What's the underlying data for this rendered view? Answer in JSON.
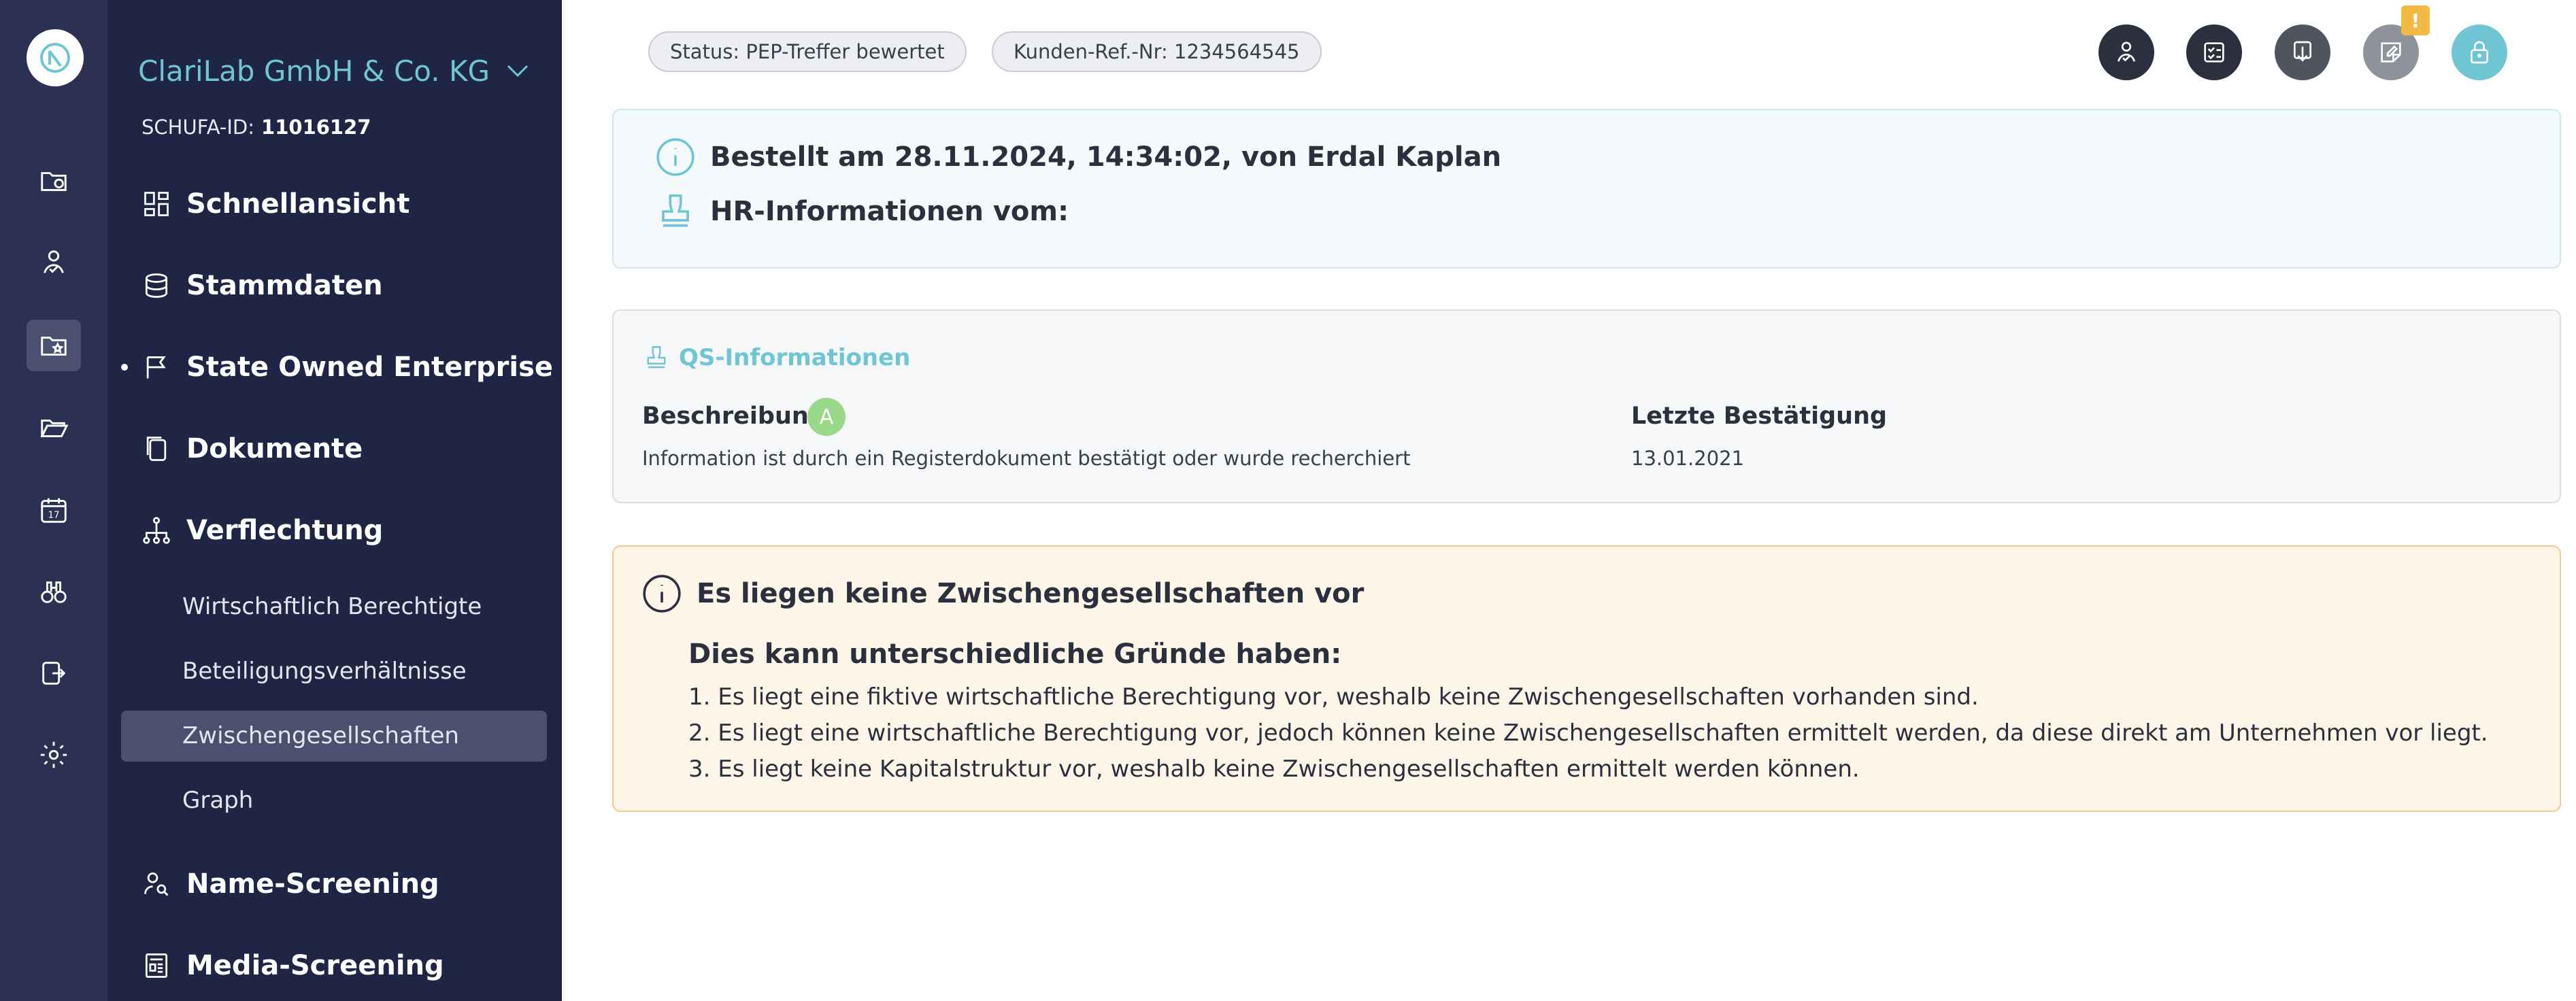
{
  "sidebar": {
    "company": "ClariLab GmbH & Co. KG",
    "schufa_label": "SCHUFA-ID:",
    "schufa_id": "11016127",
    "nav": [
      {
        "label": "Schnellansicht",
        "icon": "dashboard-icon"
      },
      {
        "label": "Stammdaten",
        "icon": "database-icon"
      },
      {
        "label": "State Owned Enterprise",
        "icon": "flag-icon"
      },
      {
        "label": "Dokumente",
        "icon": "documents-icon"
      },
      {
        "label": "Verflechtung",
        "icon": "hierarchy-icon"
      },
      {
        "label": "Name-Screening",
        "icon": "person-search-icon"
      },
      {
        "label": "Media-Screening",
        "icon": "newspaper-icon"
      }
    ],
    "sub": [
      "Wirtschaftlich Berechtigte",
      "Beteiligungsverhältnisse",
      "Zwischengesellschaften",
      "Graph"
    ]
  },
  "header": {
    "status": "Status: PEP-Treffer bewertet",
    "ref": "Kunden-Ref.-Nr: 1234564545",
    "warning_badge": "!"
  },
  "info": {
    "ordered": "Bestellt am 28.11.2024, 14:34:02, von Erdal Kaplan",
    "hr": "HR-Informationen vom:"
  },
  "qs": {
    "title": "QS-Informationen",
    "desc_label": "Beschreibung",
    "desc_badge": "A",
    "desc_value": "Information ist durch ein Registerdokument bestätigt oder wurde recherchiert",
    "confirm_label": "Letzte Bestätigung",
    "confirm_value": "13.01.2021"
  },
  "notice": {
    "title": "Es liegen keine Zwischengesellschaften vor",
    "subtitle": "Dies kann unterschiedliche Gründe haben:",
    "items": [
      "1. Es liegt eine fiktive wirtschaftliche Berechtigung vor, weshalb keine Zwischengesellschaften vorhanden sind.",
      "2. Es liegt eine wirtschaftliche Berechtigung vor, jedoch können keine Zwischengesellschaften ermittelt werden, da diese direkt am Unternehmen vor liegt.",
      "3. Es liegt keine Kapitalstruktur vor, weshalb keine Zwischengesellschaften ermittelt werden können."
    ]
  },
  "colors": {
    "accent": "#6fc5d3",
    "sidebar": "#1f2544",
    "rail": "#2b3152",
    "warning": "#f2b944"
  }
}
